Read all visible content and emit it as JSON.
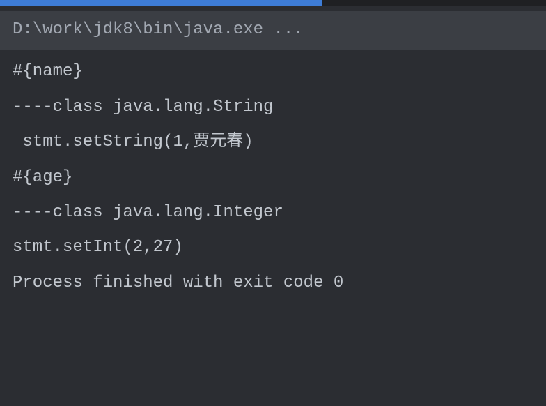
{
  "console": {
    "command": "D:\\work\\jdk8\\bin\\java.exe ...",
    "lines": [
      "#{name}",
      "----class java.lang.String",
      " stmt.setString(1,贾元春)",
      "#{age}",
      "----class java.lang.Integer",
      "stmt.setInt(2,27)",
      "",
      "Process finished with exit code 0"
    ]
  }
}
